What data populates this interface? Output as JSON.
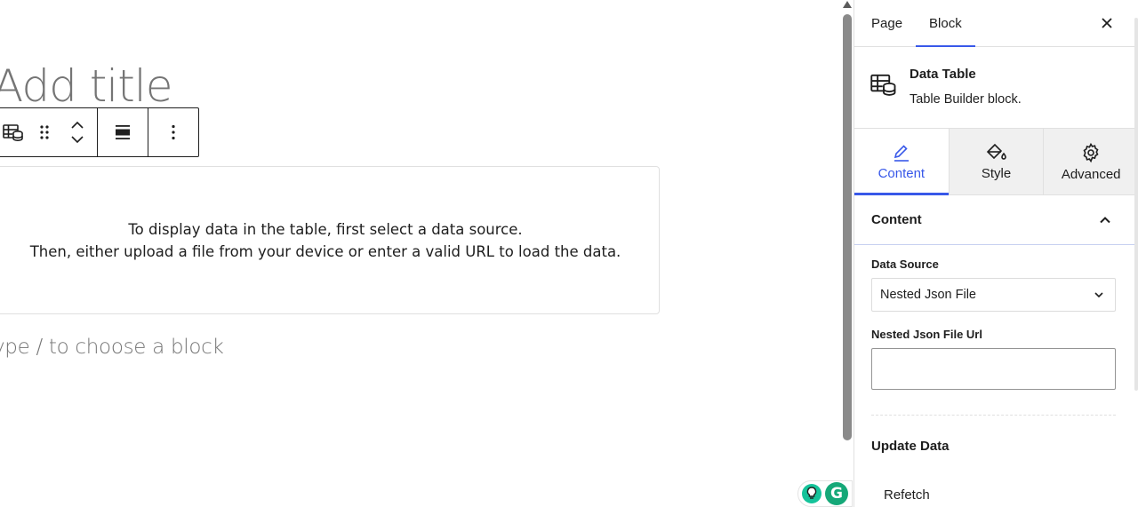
{
  "editor": {
    "title_placeholder": "Add title",
    "placeholder_lines": [
      "To display data in the table, first select a data source.",
      "Then, either upload a file from your device or enter a valid URL to load the data."
    ],
    "appender_placeholder": "ype / to choose a block"
  },
  "toolbar": {
    "items": [
      "table-database-icon",
      "drag-handle-icon",
      "move-up-icon",
      "move-down-icon",
      "align-wide-icon",
      "more-options-icon"
    ]
  },
  "grammarly": {
    "g_letter": "G"
  },
  "sidebar": {
    "tabs": [
      {
        "label": "Page",
        "active": false
      },
      {
        "label": "Block",
        "active": true
      }
    ],
    "close_icon": "close-icon",
    "block_card": {
      "title": "Data Table",
      "description": "Table Builder block."
    },
    "inner_tabs": [
      {
        "label": "Content",
        "icon": "pencil-icon",
        "active": true
      },
      {
        "label": "Style",
        "icon": "paint-bucket-icon",
        "active": false
      },
      {
        "label": "Advanced",
        "icon": "gear-icon",
        "active": false
      }
    ],
    "panel": {
      "title": "Content",
      "data_source_label": "Data Source",
      "data_source_value": "Nested Json File",
      "url_label": "Nested Json File Url",
      "url_value": "",
      "update_title": "Update Data",
      "refetch_label": "Refetch"
    }
  },
  "colors": {
    "accent": "#3858e9",
    "text": "#1e1e1e",
    "placeholder": "#757575",
    "grammarly_green": "#15c39a"
  }
}
